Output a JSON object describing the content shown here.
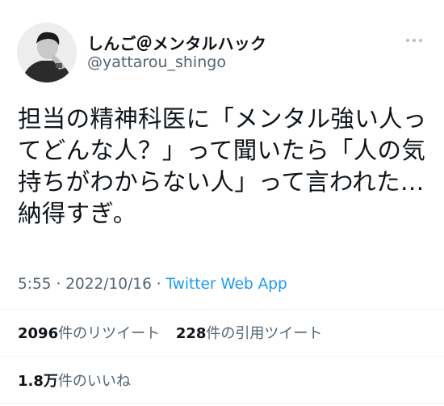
{
  "author": {
    "display_name": "しんご＠メンタルハック",
    "handle": "@yattarou_shingo"
  },
  "tweet": {
    "text": "担当の精神科医に「メンタル強い人っ\nてどんな人？」って聞いたら「人の気\n持ちがわからない人」って言われた…\n納得すぎ。"
  },
  "meta": {
    "time": "5:55",
    "separator": "·",
    "date": "2022/10/16",
    "app": "Twitter Web App"
  },
  "stats": {
    "retweets": {
      "count": "2096",
      "label": "件のリツイート"
    },
    "quotes": {
      "count": "228",
      "label": "件の引用ツイート"
    },
    "likes": {
      "count": "1.8万",
      "label": "件のいいね"
    }
  },
  "icons": {
    "more": "more-dots-icon",
    "avatar": "avatar-photo"
  },
  "colors": {
    "link": "#1d9bf0",
    "secondary": "#536471",
    "text": "#0f1419"
  }
}
